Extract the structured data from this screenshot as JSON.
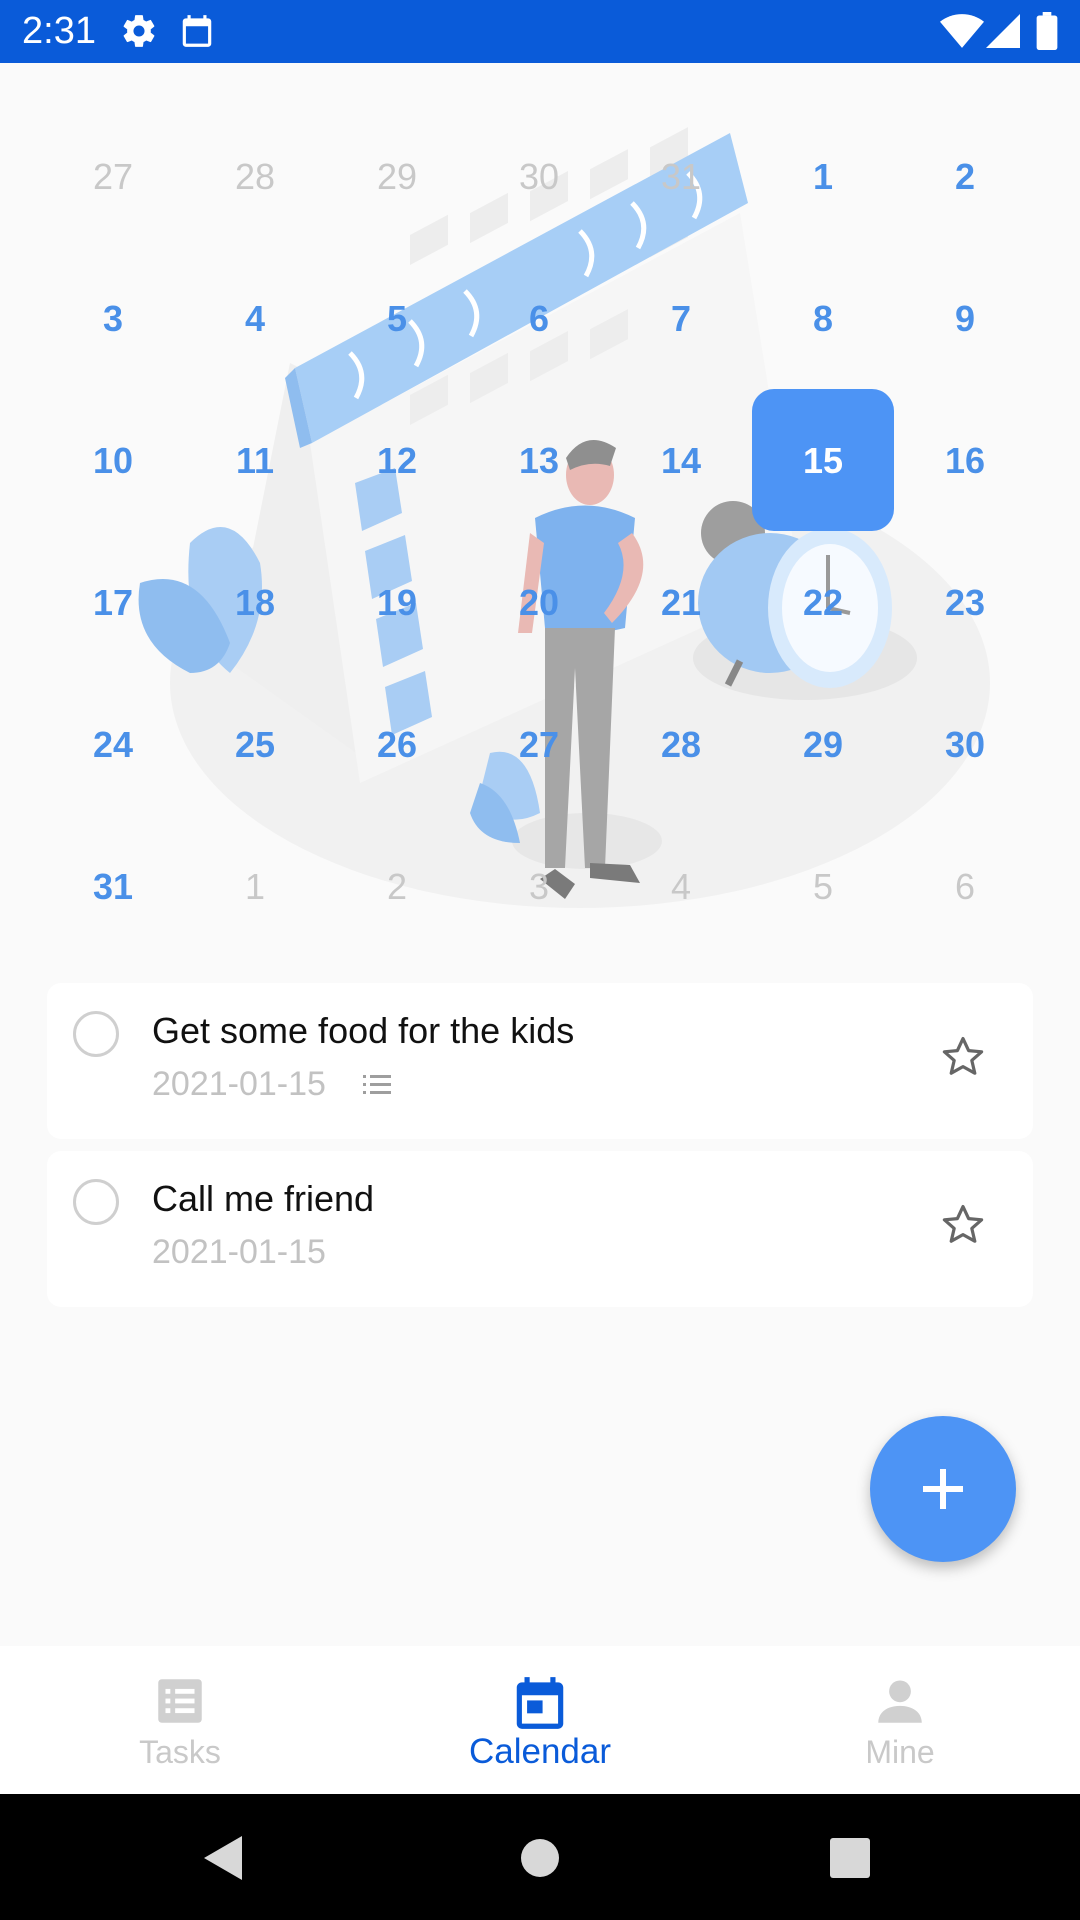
{
  "status_bar": {
    "time": "2:31",
    "icons": [
      "gear-icon",
      "calendar-small-icon",
      "wifi-icon",
      "signal-icon",
      "battery-icon"
    ]
  },
  "calendar": {
    "selected_day": "15",
    "weeks": [
      [
        {
          "d": "27",
          "m": "prev"
        },
        {
          "d": "28",
          "m": "prev"
        },
        {
          "d": "29",
          "m": "prev"
        },
        {
          "d": "30",
          "m": "prev"
        },
        {
          "d": "31",
          "m": "prev"
        },
        {
          "d": "1",
          "m": "cur"
        },
        {
          "d": "2",
          "m": "cur"
        }
      ],
      [
        {
          "d": "3",
          "m": "cur"
        },
        {
          "d": "4",
          "m": "cur"
        },
        {
          "d": "5",
          "m": "cur"
        },
        {
          "d": "6",
          "m": "cur"
        },
        {
          "d": "7",
          "m": "cur"
        },
        {
          "d": "8",
          "m": "cur"
        },
        {
          "d": "9",
          "m": "cur"
        }
      ],
      [
        {
          "d": "10",
          "m": "cur"
        },
        {
          "d": "11",
          "m": "cur"
        },
        {
          "d": "12",
          "m": "cur"
        },
        {
          "d": "13",
          "m": "cur"
        },
        {
          "d": "14",
          "m": "cur"
        },
        {
          "d": "15",
          "m": "sel"
        },
        {
          "d": "16",
          "m": "cur"
        }
      ],
      [
        {
          "d": "17",
          "m": "cur"
        },
        {
          "d": "18",
          "m": "cur"
        },
        {
          "d": "19",
          "m": "cur"
        },
        {
          "d": "20",
          "m": "cur"
        },
        {
          "d": "21",
          "m": "cur"
        },
        {
          "d": "22",
          "m": "cur"
        },
        {
          "d": "23",
          "m": "cur"
        }
      ],
      [
        {
          "d": "24",
          "m": "cur"
        },
        {
          "d": "25",
          "m": "cur"
        },
        {
          "d": "26",
          "m": "cur"
        },
        {
          "d": "27",
          "m": "cur"
        },
        {
          "d": "28",
          "m": "cur"
        },
        {
          "d": "29",
          "m": "cur"
        },
        {
          "d": "30",
          "m": "cur"
        }
      ],
      [
        {
          "d": "31",
          "m": "cur"
        },
        {
          "d": "1",
          "m": "next"
        },
        {
          "d": "2",
          "m": "next"
        },
        {
          "d": "3",
          "m": "next"
        },
        {
          "d": "4",
          "m": "next"
        },
        {
          "d": "5",
          "m": "next"
        },
        {
          "d": "6",
          "m": "next"
        }
      ]
    ]
  },
  "tasks": [
    {
      "title": "Get some food for the kids",
      "date": "2021-01-15",
      "has_notes": true
    },
    {
      "title": "Call me friend",
      "date": "2021-01-15",
      "has_notes": false
    }
  ],
  "bottom_nav": {
    "items": [
      {
        "label": "Tasks",
        "icon": "tasks-icon"
      },
      {
        "label": "Calendar",
        "icon": "calendar-icon"
      },
      {
        "label": "Mine",
        "icon": "person-icon"
      }
    ],
    "active": "Calendar"
  },
  "colors": {
    "accent": "#4D94F5",
    "status_bar": "#0A5BD9",
    "day_text": "#4A90E8",
    "muted": "#C8C8C8"
  }
}
